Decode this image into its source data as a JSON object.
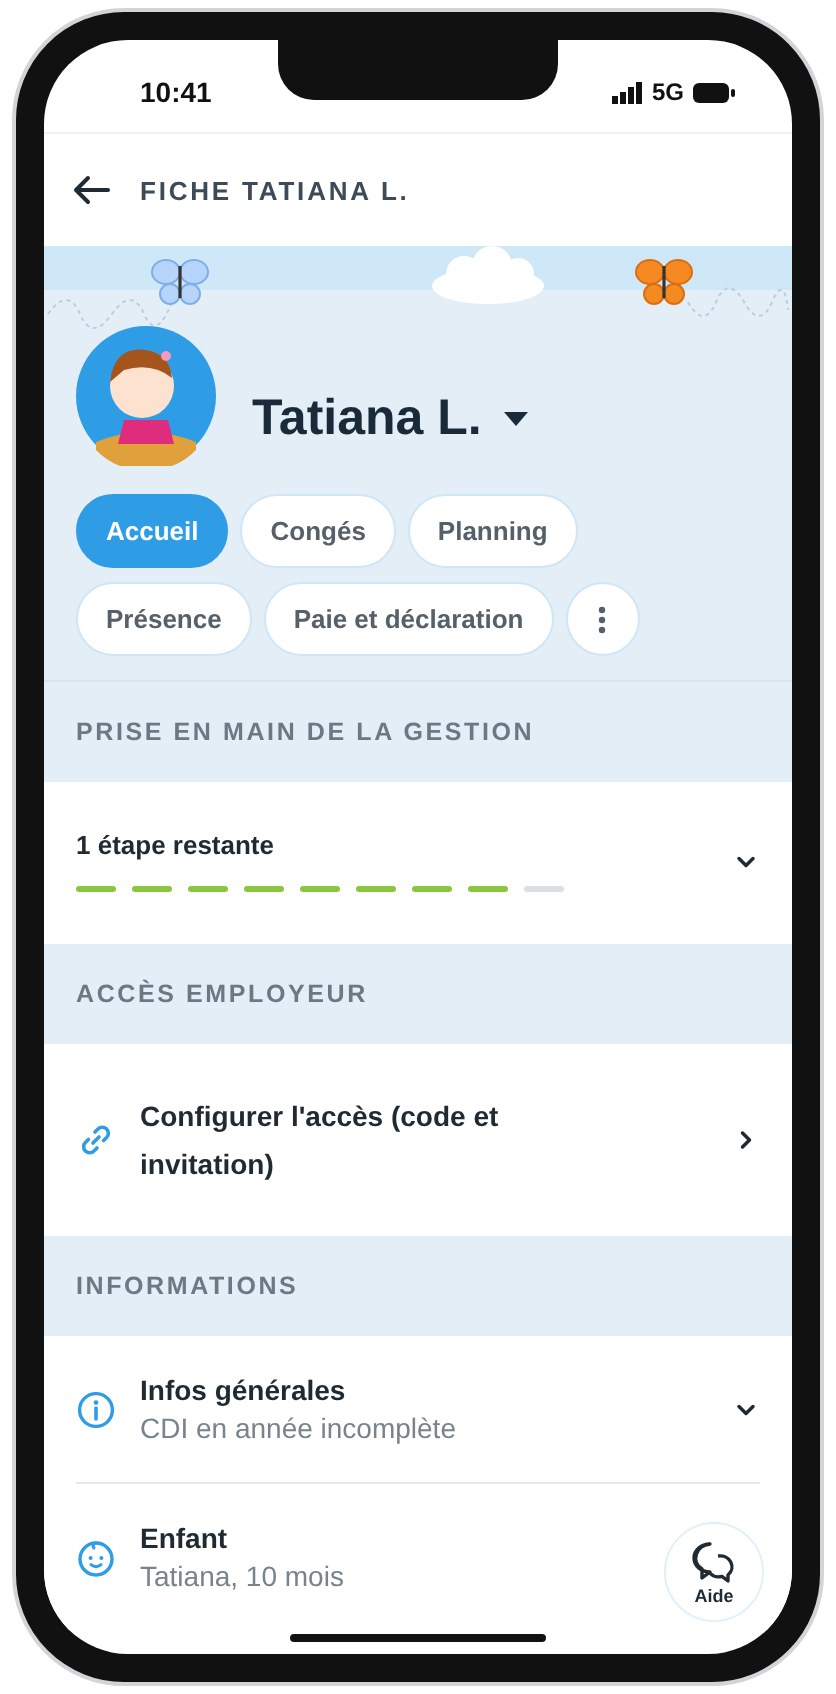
{
  "status_bar": {
    "time": "10:41",
    "network": "5G"
  },
  "header": {
    "title": "FICHE TATIANA L."
  },
  "profile": {
    "name": "Tatiana L."
  },
  "tabs": [
    {
      "kind": "tab",
      "label": "Accueil",
      "selected": true
    },
    {
      "kind": "tab",
      "label": "Congés",
      "selected": false
    },
    {
      "kind": "tab",
      "label": "Planning",
      "selected": false
    },
    {
      "kind": "tab",
      "label": "Présence",
      "selected": false
    },
    {
      "kind": "tab",
      "label": "Paie et déclaration",
      "selected": false
    },
    {
      "kind": "more",
      "selected": false
    }
  ],
  "sections": [
    {
      "title": "PRISE EN MAIN DE LA GESTION",
      "rows": [
        {
          "kind": "progress",
          "title": "1 étape restante",
          "expanded": false,
          "steps": [
            {
              "done": true
            },
            {
              "done": true
            },
            {
              "done": true
            },
            {
              "done": true
            },
            {
              "done": true
            },
            {
              "done": true
            },
            {
              "done": true
            },
            {
              "done": true
            },
            {
              "done": false
            }
          ]
        }
      ]
    },
    {
      "title": "ACCÈS EMPLOYEUR",
      "rows": [
        {
          "kind": "link",
          "title": "Configurer l'accès (code et invitation)"
        }
      ]
    },
    {
      "title": "INFORMATIONS",
      "rows": [
        {
          "kind": "details",
          "title": "Infos générales",
          "subtitle": "CDI en année incomplète",
          "expanded": false
        },
        {
          "kind": "child",
          "title": "Enfant",
          "subtitle": "Tatiana, 10 mois"
        }
      ]
    }
  ],
  "help_button": {
    "label": "Aide"
  }
}
